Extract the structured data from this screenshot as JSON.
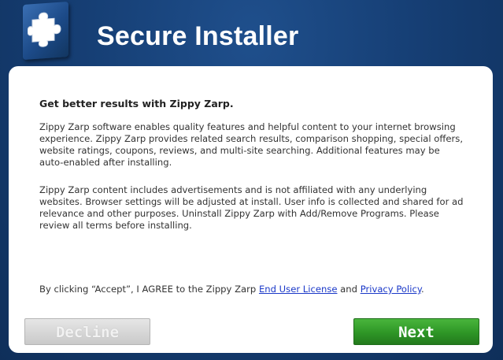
{
  "header": {
    "title": "Secure Installer",
    "logo_icon": "puzzle-piece-icon"
  },
  "content": {
    "headline": "Get better results with Zippy Zarp.",
    "paragraph1": "Zippy Zarp software enables quality features and helpful content to your internet browsing experience. Zippy Zarp provides related search results, comparison shopping, special offers, website ratings, coupons, reviews, and multi-site searching. Additional features may be auto-enabled after installing.",
    "paragraph2": "Zippy Zarp content includes advertisements and is not affiliated with any underlying websites. Browser settings will be adjusted at install. User info is collected and shared for ad relevance and other purposes. Uninstall Zippy Zarp with Add/Remove Programs. Please review all terms before installing.",
    "agreement": {
      "prefix": "By clicking “Accept”, I AGREE to the Zippy Zarp ",
      "eula_link": "End User License",
      "middle": " and ",
      "privacy_link": "Privacy Policy",
      "suffix": "."
    }
  },
  "buttons": {
    "decline": "Decline",
    "next": "Next"
  },
  "colors": {
    "background": "#163f75",
    "next_button": "#2e9626",
    "link": "#1a38c8"
  }
}
